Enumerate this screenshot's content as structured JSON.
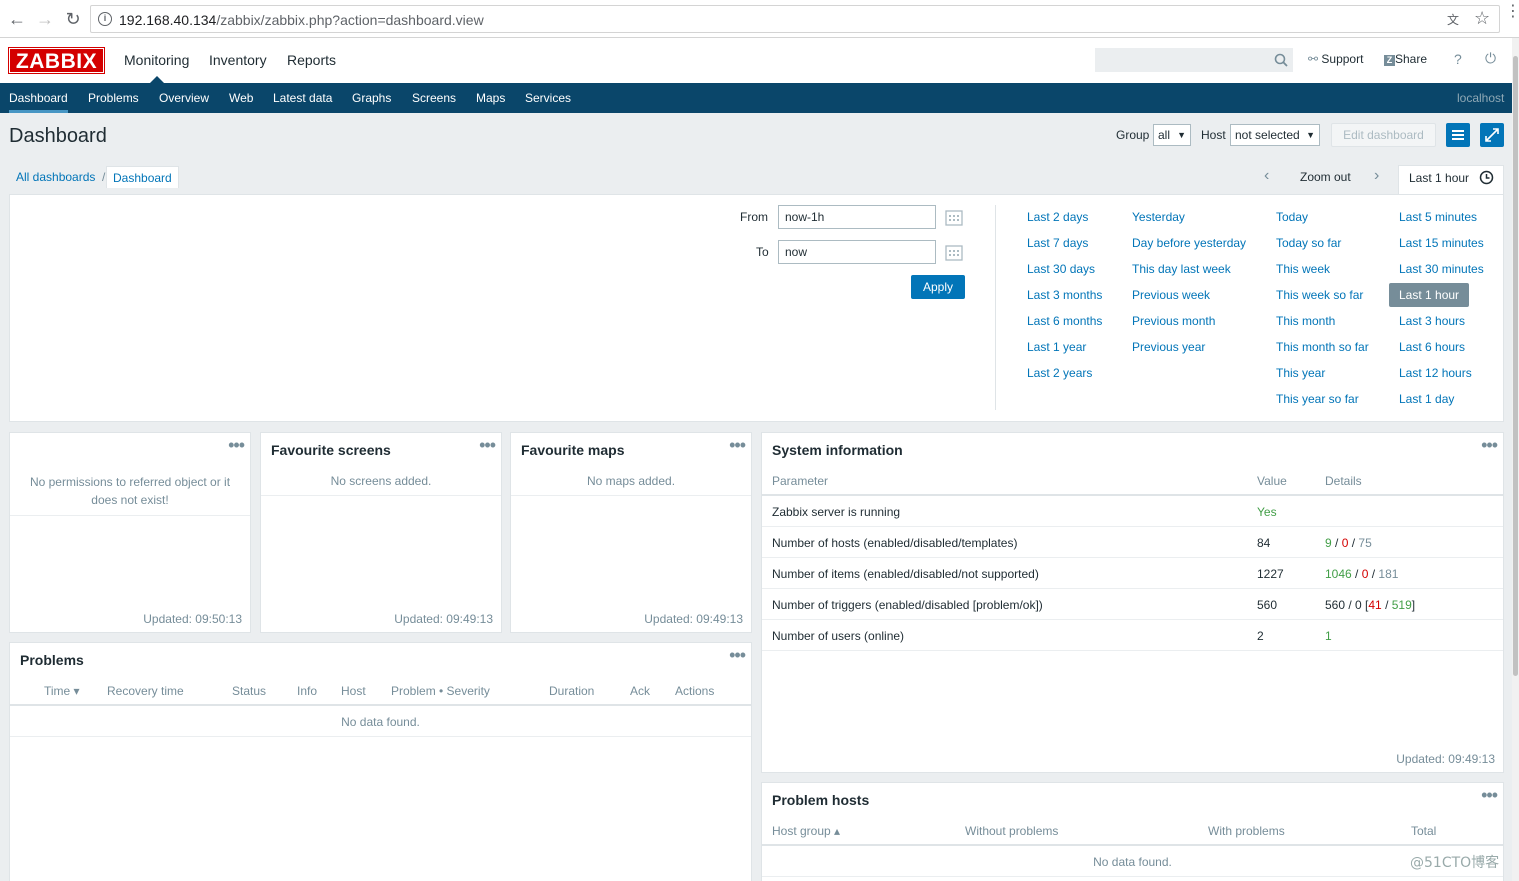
{
  "browser": {
    "url_host": "192.168.40.134",
    "url_path": "/zabbix/zabbix.php?action=dashboard.view"
  },
  "header": {
    "logo": "ZABBIX",
    "menu": [
      "Monitoring",
      "Inventory",
      "Reports"
    ],
    "support": "Support",
    "share": "Share",
    "help": "?",
    "user": "localhost"
  },
  "subnav": [
    "Dashboard",
    "Problems",
    "Overview",
    "Web",
    "Latest data",
    "Graphs",
    "Screens",
    "Maps",
    "Services"
  ],
  "page": {
    "title": "Dashboard",
    "group_label": "Group",
    "group_value": "all",
    "host_label": "Host",
    "host_value": "not selected",
    "edit_dashboard": "Edit dashboard"
  },
  "breadcrumb": [
    "All dashboards",
    "/",
    "Dashboard"
  ],
  "timebar": {
    "zoom_out": "Zoom out",
    "current": "Last 1 hour",
    "from_label": "From",
    "from_value": "now-1h",
    "to_label": "To",
    "to_value": "now",
    "apply": "Apply",
    "col1": [
      "Last 2 days",
      "Last 7 days",
      "Last 30 days",
      "Last 3 months",
      "Last 6 months",
      "Last 1 year",
      "Last 2 years"
    ],
    "col2": [
      "Yesterday",
      "Day before yesterday",
      "This day last week",
      "Previous week",
      "Previous month",
      "Previous year"
    ],
    "col3": [
      "Today",
      "Today so far",
      "This week",
      "This week so far",
      "This month",
      "This month so far",
      "This year",
      "This year so far"
    ],
    "col4": [
      "Last 5 minutes",
      "Last 15 minutes",
      "Last 30 minutes",
      "Last 1 hour",
      "Last 3 hours",
      "Last 6 hours",
      "Last 12 hours",
      "Last 1 day"
    ]
  },
  "widgets": {
    "w1": {
      "message": "No permissions to referred object or it does not exist!",
      "updated": "Updated: 09:50:13"
    },
    "w2": {
      "title": "Favourite screens",
      "message": "No screens added.",
      "updated": "Updated: 09:49:13"
    },
    "w3": {
      "title": "Favourite maps",
      "message": "No maps added.",
      "updated": "Updated: 09:49:13"
    },
    "problems": {
      "title": "Problems",
      "columns": [
        "Time ▾",
        "Recovery time",
        "Status",
        "Info",
        "Host",
        "Problem • Severity",
        "Duration",
        "Ack",
        "Actions"
      ],
      "empty": "No data found."
    },
    "sysinfo": {
      "title": "System information",
      "columns": [
        "Parameter",
        "Value",
        "Details"
      ],
      "rows": [
        {
          "param": "Zabbix server is running",
          "value": "Yes"
        },
        {
          "param": "Number of hosts (enabled/disabled/templates)",
          "value": "84",
          "d1": "9",
          "d2": "0",
          "d3": "75"
        },
        {
          "param": "Number of items (enabled/disabled/not supported)",
          "value": "1227",
          "d1": "1046",
          "d2": "0",
          "d3": "181"
        },
        {
          "param": "Number of triggers (enabled/disabled [problem/ok])",
          "value": "560",
          "d1": "560 / 0 [",
          "d2": "41",
          "d3": "519"
        },
        {
          "param": "Number of users (online)",
          "value": "2",
          "d1": "1"
        }
      ],
      "updated": "Updated: 09:49:13"
    },
    "problemhosts": {
      "title": "Problem hosts",
      "columns": [
        "Host group ▴",
        "Without problems",
        "With problems",
        "Total"
      ],
      "empty": "No data found."
    }
  },
  "watermark": "@51CTO博客",
  "colors": {
    "brand_red": "#d40000",
    "nav_blue": "#0a466a",
    "link": "#0275b8",
    "ok_green": "#429e47"
  }
}
